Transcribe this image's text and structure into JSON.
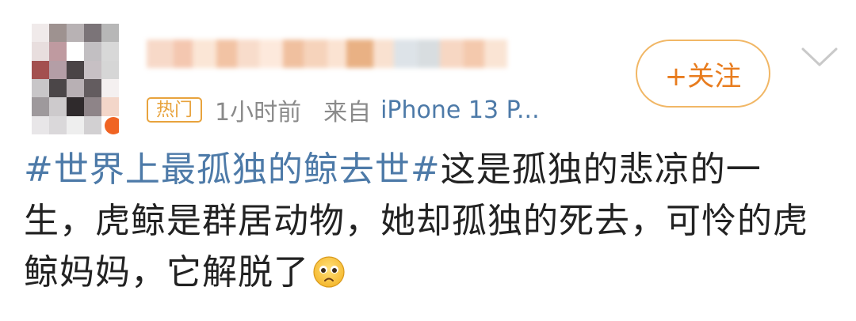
{
  "post": {
    "avatar_colors": [
      "#f0eaea",
      "#9e9290",
      "#b8b2b4",
      "#7b7478",
      "#b7b7b7",
      "#e8dede",
      "#bf9aa0",
      "#ffffff",
      "#c2bfc2",
      "#d8d8d8",
      "#a3504f",
      "#b49ea6",
      "#4a4446",
      "#c7c0c4",
      "#d6d6d6",
      "#c8c6c8",
      "#4b4648",
      "#b8b0b4",
      "#635c5f",
      "#f4f0f0",
      "#9e999c",
      "#cdcacc",
      "#2f2a2c",
      "#8e8488",
      "#f3d6c9",
      "#e8e6e8",
      "#dad8da",
      "#eeeeee",
      "#d2d0d2",
      "#ffffff"
    ],
    "username_colors": [
      "#f7d9c8",
      "#f4c7b0",
      "#fbe6d6",
      "#f2c3a4",
      "#f8dccb",
      "#fde9dc",
      "#f0c09f",
      "#f6d3bb",
      "#fbe3d2",
      "#e9b184",
      "#f9e1d0",
      "#dde3e8",
      "#d8dde0",
      "#f7d7c3",
      "#f4c9ad",
      "#fae4d4"
    ],
    "hot_label": "热门",
    "time": "1小时前",
    "source_prefix": "来自",
    "source_device": "iPhone 13 P...",
    "follow_label": "+关注",
    "topic": "#世界上最孤独的鲸去世#",
    "text": "这是孤独的悲凉的一生，虎鲸是群居动物，她却孤独的死去，可怜的虎鲸妈妈，它解脱了",
    "emoji": "sad-face-emoji",
    "colors": {
      "hot_badge": "#e8a33d",
      "follow_text": "#e87c1e",
      "follow_border": "#f1b766",
      "topic_link": "#4d7aa8",
      "meta_gray": "#8a8a8a",
      "body_text": "#222222"
    }
  }
}
